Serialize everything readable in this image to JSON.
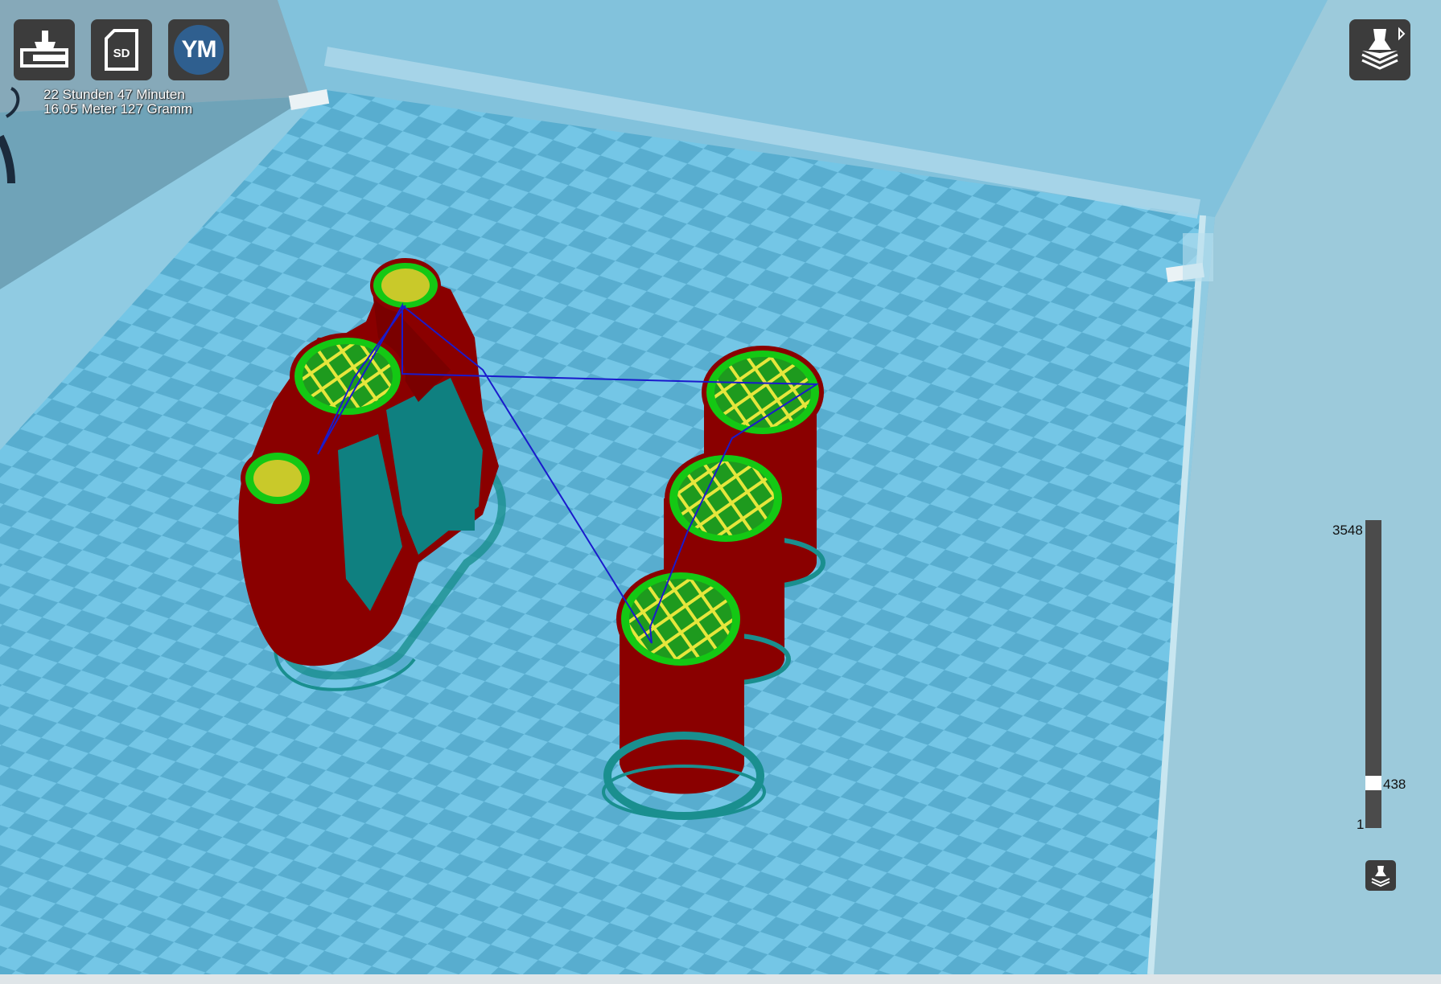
{
  "toolbar": {
    "print_icon": "print-to-file-icon",
    "sd_icon": "sd-card-icon",
    "sd_label": "SD",
    "profile_initials": "YM"
  },
  "print_info": {
    "duration": "22 Stunden 47 Minuten",
    "material": "16.05 Meter 127 Gramm"
  },
  "view_mode": {
    "icon": "layer-view-icon"
  },
  "layer_slider": {
    "max": "3548",
    "current": "438",
    "min": "1",
    "current_value": 438,
    "max_value": 3548
  },
  "colors": {
    "build_plate_light": "#74c6e6",
    "build_plate_dark": "#58adcf",
    "wall_outer": "#8a0000",
    "wall_inner": "#14c814",
    "infill": "#e6e63c",
    "skirt": "#1a8f8f",
    "travel": "#1a1acc"
  }
}
